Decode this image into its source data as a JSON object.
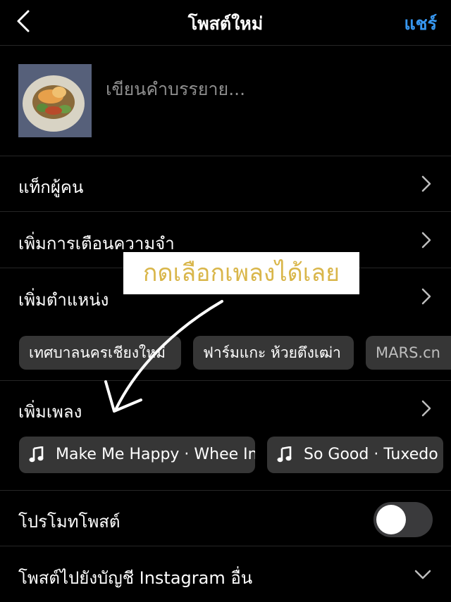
{
  "header": {
    "title": "โพสต์ใหม่",
    "share_label": "แชร์"
  },
  "composer": {
    "caption_placeholder": "เขียนคำบรรยาย..."
  },
  "rows": {
    "tag_people": "แท็กผู้คน",
    "add_reminder": "เพิ่มการเตือนความจำ",
    "add_location": "เพิ่มตำแหน่ง",
    "add_music": "เพิ่มเพลง",
    "promote": "โปรโมทโพสต์",
    "post_other": "โพสต์ไปยังบัญชี Instagram อื่น"
  },
  "location_suggestions": [
    "เทศบาลนครเชียงใหม่",
    "ฟาร์มแกะ ห้วยตึงเฒ่า",
    "MARS.cn"
  ],
  "music_suggestions": [
    "Make Me Happy · Whee In",
    "So Good · Tuxedo"
  ],
  "promote_toggle": {
    "on": false
  },
  "annotation": {
    "text": "กดเลือกเพลงได้เลย"
  },
  "colors": {
    "accent": "#3797f0",
    "annotation_text": "#d9b64a"
  }
}
